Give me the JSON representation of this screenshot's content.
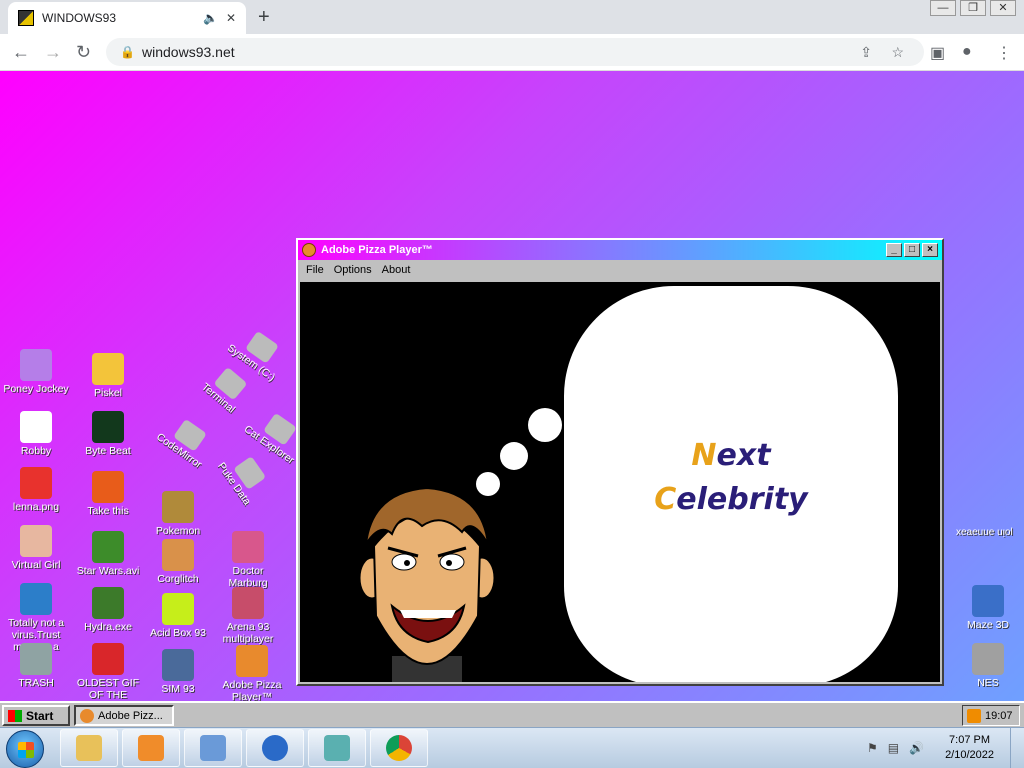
{
  "browser": {
    "tab_title": "WINDOWS93",
    "url": "windows93.net"
  },
  "desktop_icons_left": [
    {
      "label": "Poney Jockey",
      "color": "#b57ee8"
    },
    {
      "label": "Piskel",
      "color": "#f3c43a"
    },
    {
      "label": "Robby",
      "color": "#ffffff"
    },
    {
      "label": "Byte Beat",
      "color": "#12381c"
    },
    {
      "label": "lenna.png",
      "color": "#e8322d"
    },
    {
      "label": "Take this",
      "color": "#e85c1a"
    },
    {
      "label": "Virtual Girl",
      "color": "#e7b7a0"
    },
    {
      "label": "Star Wars.avi",
      "color": "#3d8c2a"
    },
    {
      "label": "Totally not a virus.Trust me...I'm a dolphin",
      "color": "#2c7ec9"
    },
    {
      "label": "Hydra.exe",
      "color": "#3c7a2a"
    },
    {
      "label": "TRASH",
      "color": "#8fa3a3"
    },
    {
      "label": "OLDEST GIF OF THE",
      "color": "#d9262a"
    },
    {
      "label": "Pokemon",
      "color": "#b08a3a"
    },
    {
      "label": "Corglitch",
      "color": "#d9914a"
    },
    {
      "label": "Acid Box 93",
      "color": "#c6ee1a"
    },
    {
      "label": "SIM 93",
      "color": "#4a6a9a"
    },
    {
      "label": "Doctor Marburg",
      "color": "#d8578c"
    },
    {
      "label": "Arena 93 multiplayer",
      "color": "#c74d6a"
    },
    {
      "label": "Adobe Pizza Player™",
      "color": "#e88a2d"
    }
  ],
  "desktop_icons_tilted": [
    {
      "label": "System (C:)"
    },
    {
      "label": "Terminal"
    },
    {
      "label": "CodeMirror"
    },
    {
      "label": "Cat Explorer"
    },
    {
      "label": "Puke Data"
    }
  ],
  "desktop_icons_right": [
    {
      "label": "Maze 3D",
      "color": "#3a6fc8"
    },
    {
      "label": "NES",
      "color": "#a0a0a0"
    }
  ],
  "right_mirror_text": "xeaeuue uᴉol",
  "pizza_window": {
    "title": "Adobe Pizza Player™",
    "menu": [
      "File",
      "Options",
      "About"
    ],
    "bubble_line1_cap": "N",
    "bubble_line1_rest": "ext",
    "bubble_line2_cap": "C",
    "bubble_line2_rest": "elebrity"
  },
  "taskbar93": {
    "start": "Start",
    "task": "Adobe Pizz...",
    "time": "19:07"
  },
  "taskbar7": {
    "time": "7:07 PM",
    "date": "2/10/2022"
  }
}
